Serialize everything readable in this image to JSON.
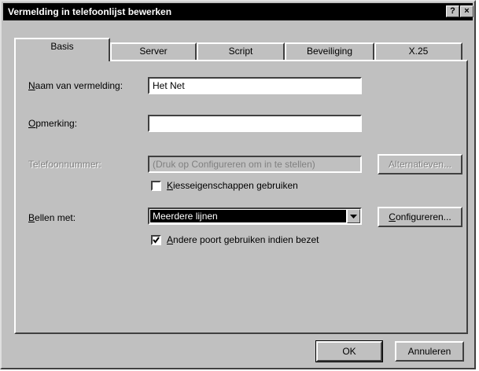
{
  "window": {
    "title": "Vermelding in telefoonlijst bewerken",
    "help_label": "?",
    "close_label": "×"
  },
  "tabs": [
    {
      "label": "Basis",
      "active": true
    },
    {
      "label": "Server",
      "active": false
    },
    {
      "label": "Script",
      "active": false
    },
    {
      "label": "Beveiliging",
      "active": false
    },
    {
      "label": "X.25",
      "active": false
    }
  ],
  "form": {
    "entry_name": {
      "label_hot": "N",
      "label_rest": "aam van vermelding:",
      "value": "Het Net"
    },
    "comment": {
      "label_hot": "O",
      "label_rest": "pmerking:",
      "value": ""
    },
    "phone_number": {
      "label": "Telefoonnummer:",
      "value": "(Druk op Configureren om in te stellen)",
      "button": "Alternatieven..."
    },
    "dialing_props": {
      "label_hot": "K",
      "label_rest": "iesseigenschappen gebruiken",
      "checked": false
    },
    "dial_using": {
      "label_hot": "B",
      "label_rest": "ellen met:",
      "selected": "Meerdere lijnen",
      "button_hot": "C",
      "button_rest": "onfigureren..."
    },
    "other_port": {
      "label_hot": "A",
      "label_rest": "ndere poort gebruiken indien bezet",
      "checked": true
    }
  },
  "footer": {
    "ok_label": "OK",
    "cancel_label": "Annuleren"
  }
}
